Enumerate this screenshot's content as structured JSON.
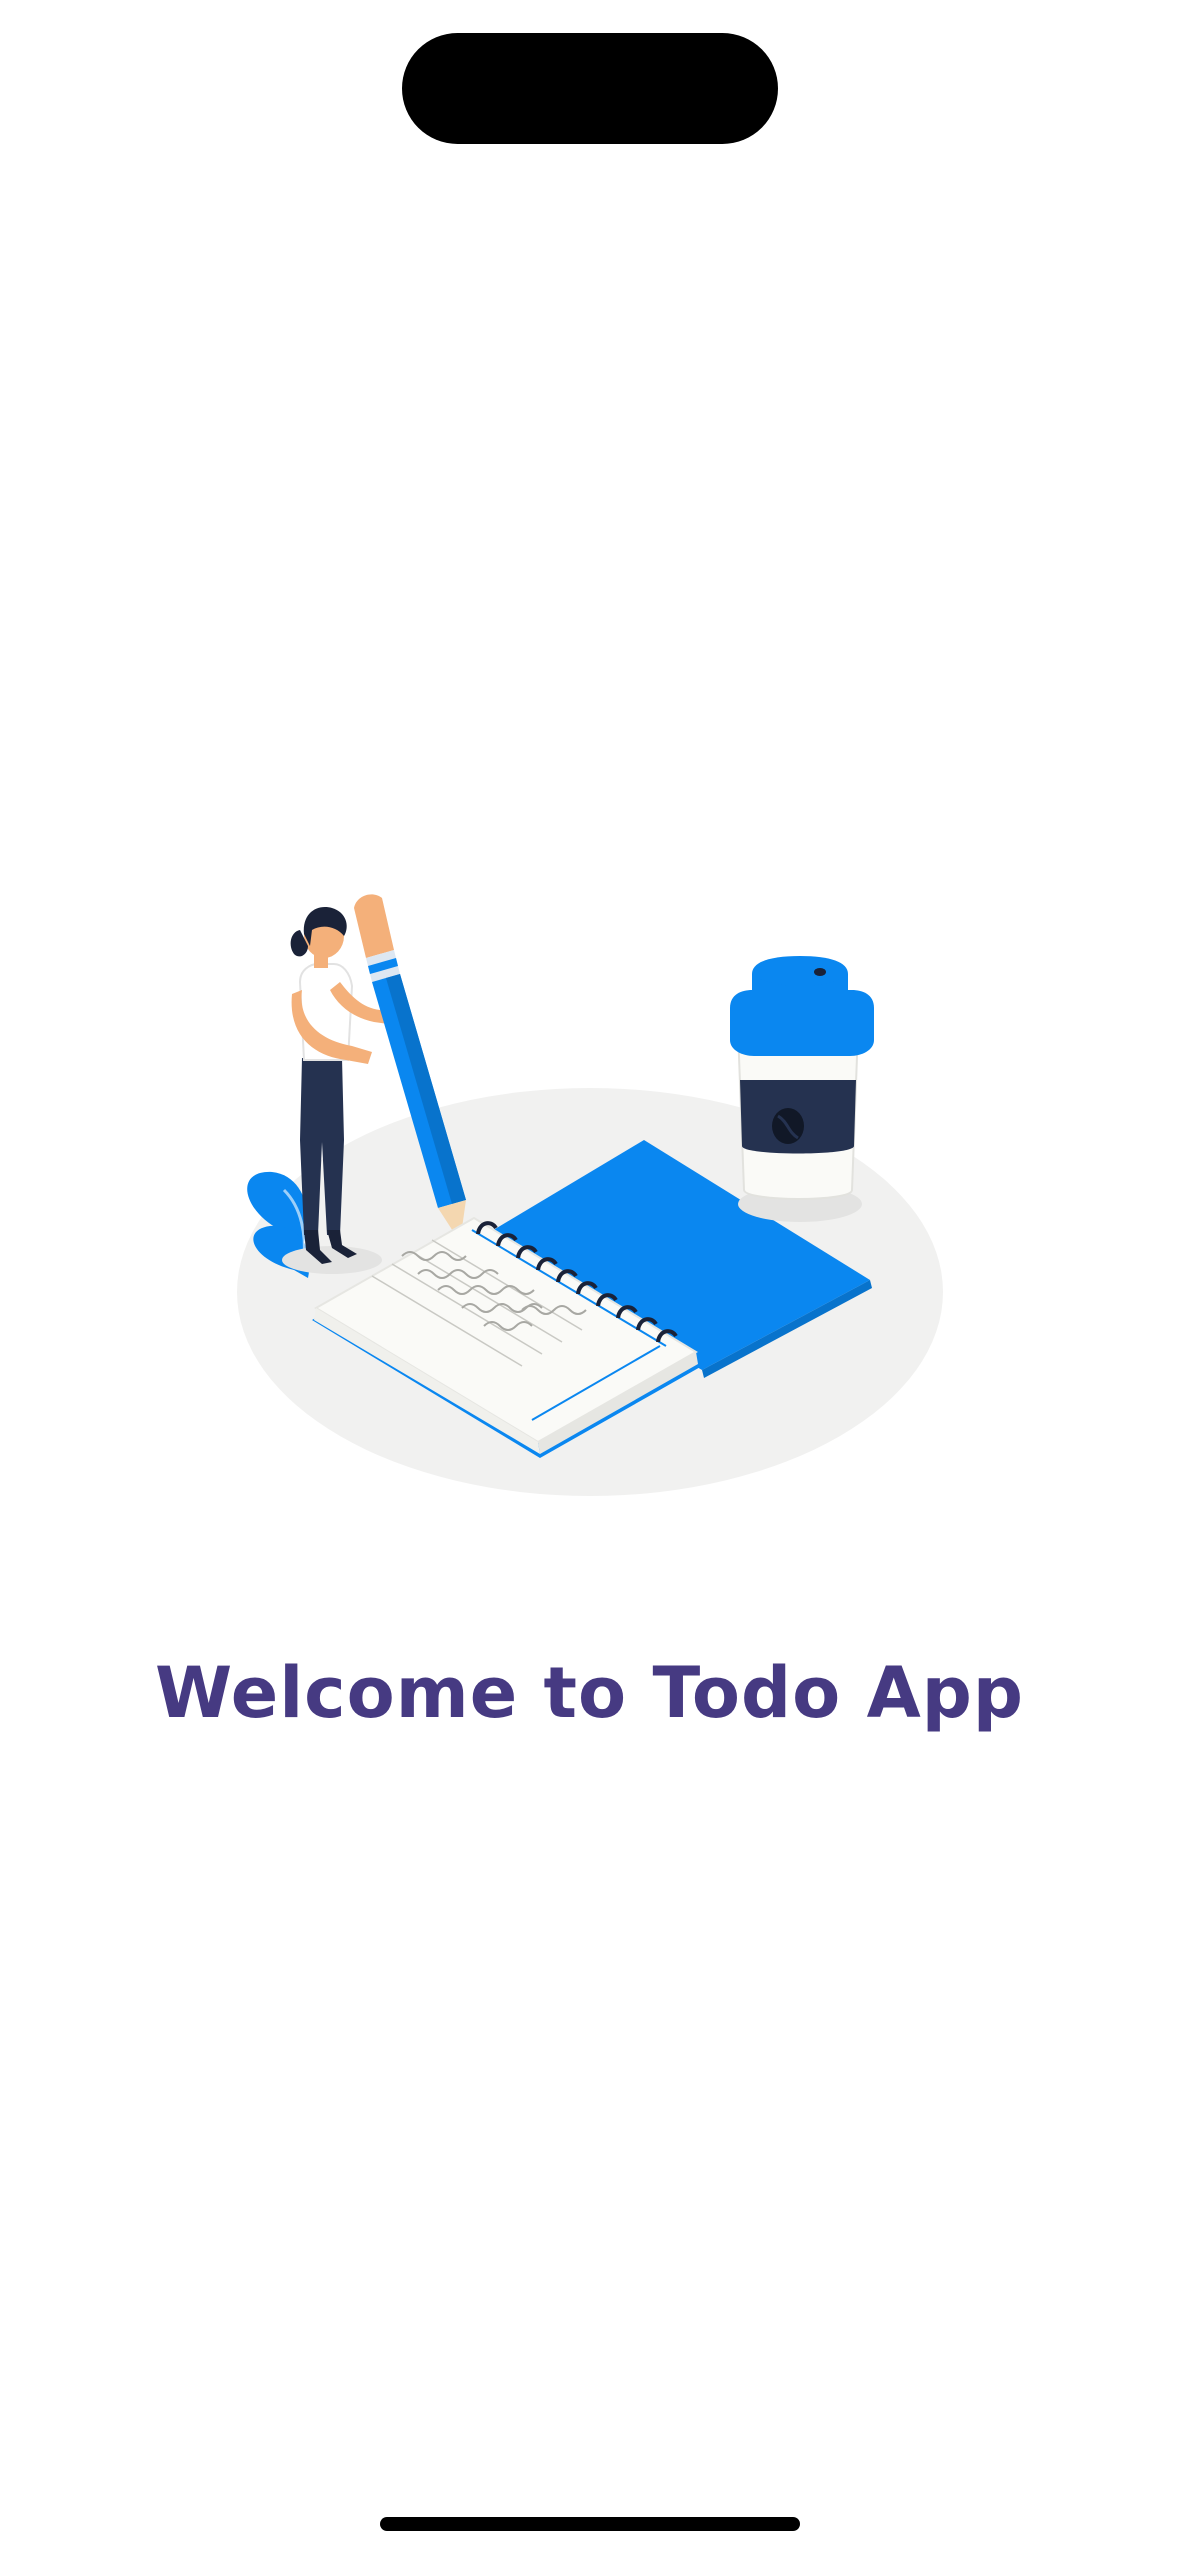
{
  "welcome": {
    "title": "Welcome to Todo App"
  },
  "illustration": {
    "icon": "notebook-writing-illustration",
    "colors": {
      "primary_blue": "#0A87F0",
      "floor": "#F1F1F0",
      "navy": "#253250",
      "skin": "#F4B07A",
      "title_purple": "#463A82"
    }
  }
}
